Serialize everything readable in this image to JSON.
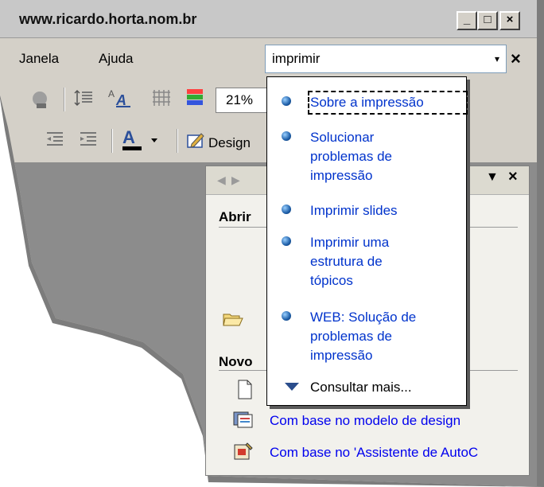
{
  "window": {
    "title": "www.ricardo.horta.nom.br"
  },
  "window_buttons": {
    "minimize": "_",
    "maximize": "□",
    "close": "×"
  },
  "menu": {
    "janela": "Janela",
    "ajuda": "Ajuda"
  },
  "ask": {
    "value": "imprimir",
    "dropdown_glyph": "▾",
    "close_glyph": "×"
  },
  "toolbar": {
    "zoom": "21%",
    "design_label": "Design"
  },
  "dropdown": {
    "items": [
      {
        "label": "Sobre a impressão"
      },
      {
        "label": "Solucionar problemas de impressão"
      },
      {
        "label": "Imprimir slides"
      },
      {
        "label": "Imprimir uma estrutura de tópicos"
      },
      {
        "label": "WEB: Solução de problemas de impressão"
      }
    ],
    "more_label": "Consultar mais..."
  },
  "taskpane": {
    "open_section": "Abrir",
    "new_section": "Novo",
    "links": [
      {
        "label": "Com base no modelo de design"
      },
      {
        "label": "Com base no  'Assistente de AutoC"
      }
    ]
  }
}
